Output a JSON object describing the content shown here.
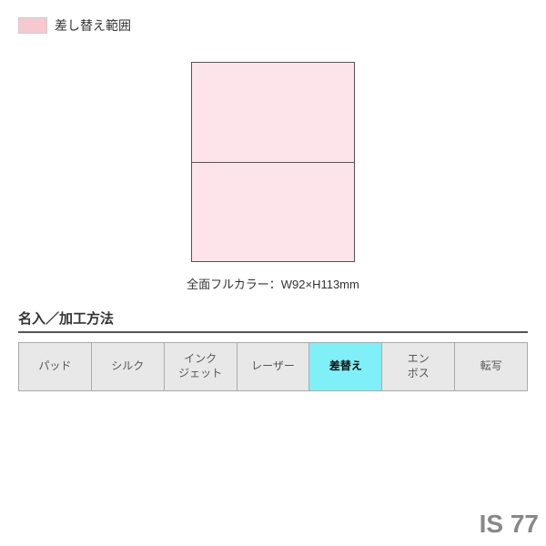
{
  "legend": {
    "swatch_color": "#f8c8d0",
    "label": "差し替え範囲"
  },
  "card": {
    "dimension_label": "全面フルカラー：W92×H113mm"
  },
  "section": {
    "title": "名入／加工方法"
  },
  "tabs": [
    {
      "id": "pad",
      "label": "パッド",
      "active": false
    },
    {
      "id": "silk",
      "label": "シルク",
      "active": false
    },
    {
      "id": "inkjet",
      "label": "インク\nジェット",
      "active": false
    },
    {
      "id": "laser",
      "label": "レーザー",
      "active": false
    },
    {
      "id": "sashikae",
      "label": "差替え",
      "active": true
    },
    {
      "id": "emboss",
      "label": "エン\nボス",
      "active": false
    },
    {
      "id": "tenshya",
      "label": "転写",
      "active": false
    }
  ],
  "badge": {
    "text": "IS 77"
  }
}
